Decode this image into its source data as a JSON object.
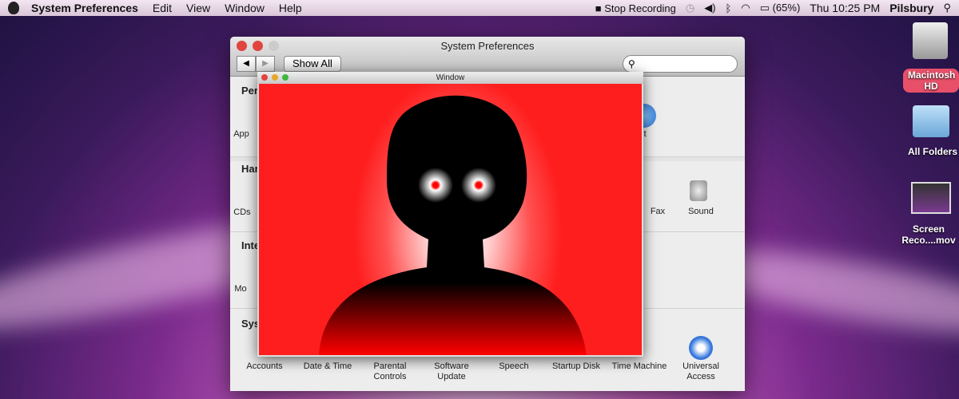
{
  "menubar": {
    "app": "System Preferences",
    "items": [
      "Edit",
      "View",
      "Window",
      "Help"
    ],
    "status": {
      "recording": "Stop Recording",
      "battery": "(65%)",
      "clock": "Thu 10:25 PM",
      "user": "Pilsbury"
    }
  },
  "prefs": {
    "title": "System Preferences",
    "show_all": "Show All",
    "search_placeholder": "",
    "sections": [
      "Per",
      "Har",
      "Inte",
      "Sys"
    ],
    "partial_labels": {
      "left1": "App",
      "left2": "CDs",
      "left3": "Mo",
      "right1": "ght",
      "right2": "Fax",
      "right3": "Sound"
    },
    "system_items": [
      "Accounts",
      "Date & Time",
      "Parental Controls",
      "Software Update",
      "Speech",
      "Startup Disk",
      "Time Machine",
      "Universal Access"
    ]
  },
  "window": {
    "title": "Window"
  },
  "desktop": [
    {
      "label": "Macintosh HD"
    },
    {
      "label": "All Folders"
    },
    {
      "label": "Screen Reco....mov"
    }
  ],
  "colors": {
    "accent": "#ff1e1e",
    "eye": "#ff0000"
  }
}
